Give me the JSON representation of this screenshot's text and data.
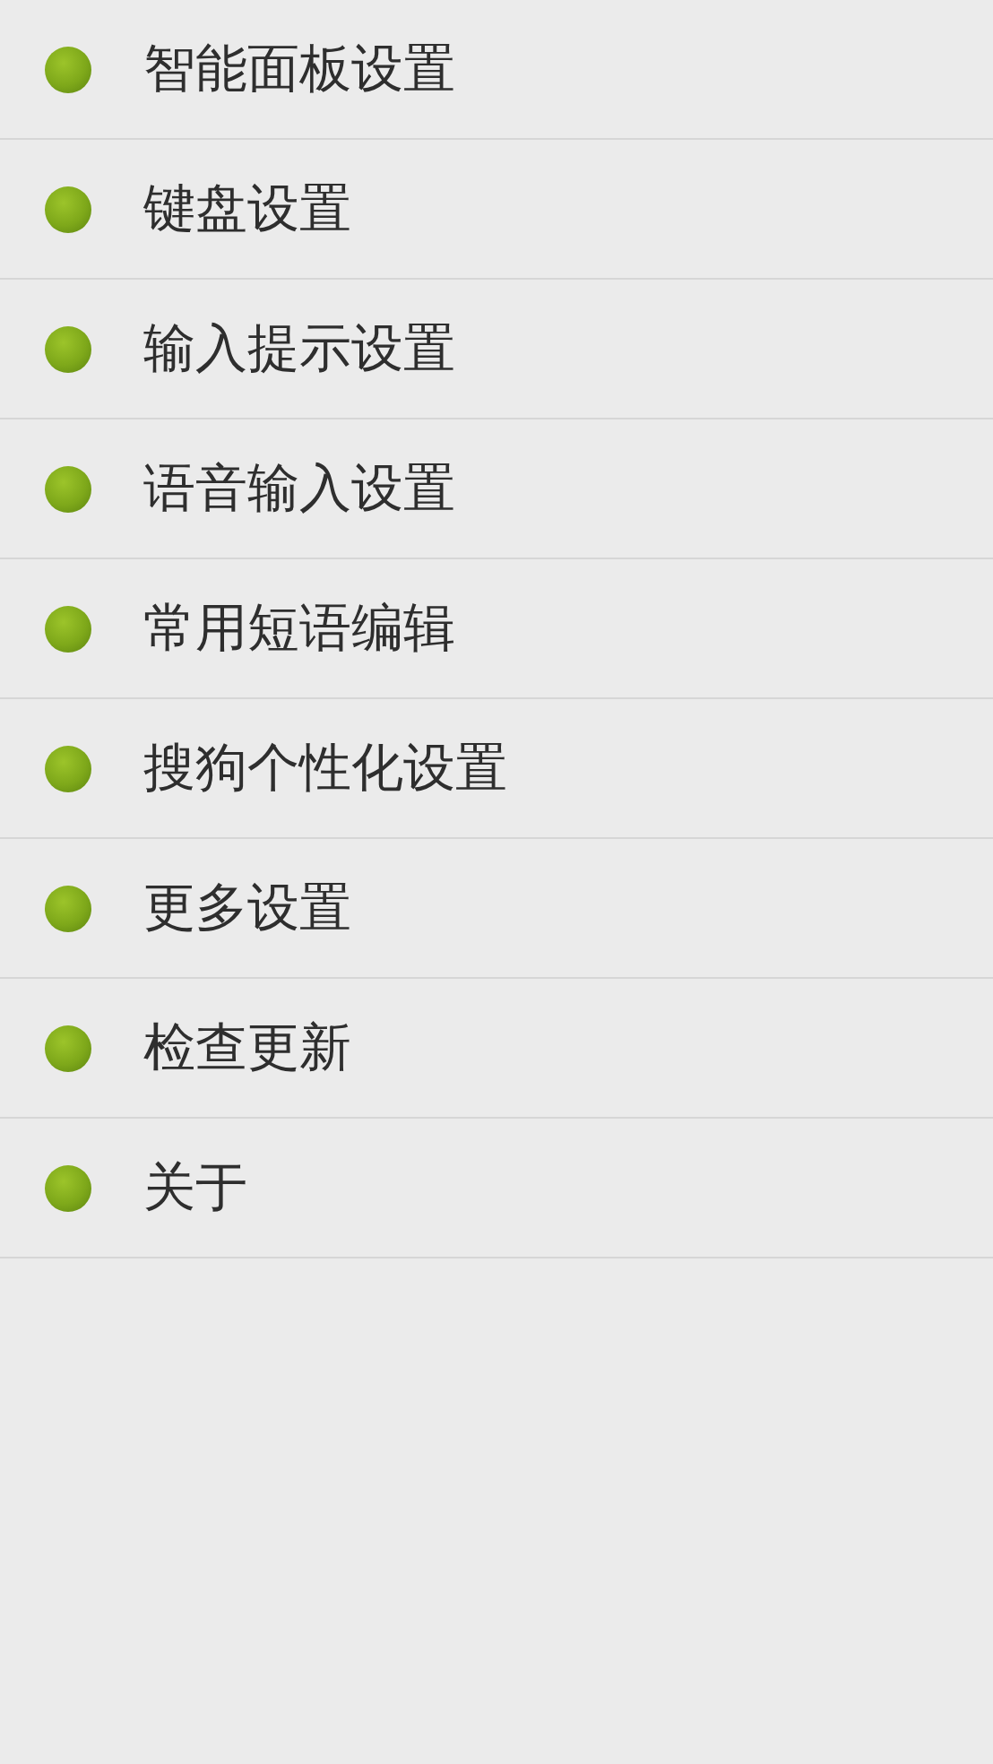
{
  "menu": {
    "items": [
      {
        "label": "智能面板设置"
      },
      {
        "label": "键盘设置"
      },
      {
        "label": "输入提示设置"
      },
      {
        "label": "语音输入设置"
      },
      {
        "label": "常用短语编辑"
      },
      {
        "label": "搜狗个性化设置"
      },
      {
        "label": "更多设置"
      },
      {
        "label": "检查更新"
      },
      {
        "label": "关于"
      }
    ]
  }
}
